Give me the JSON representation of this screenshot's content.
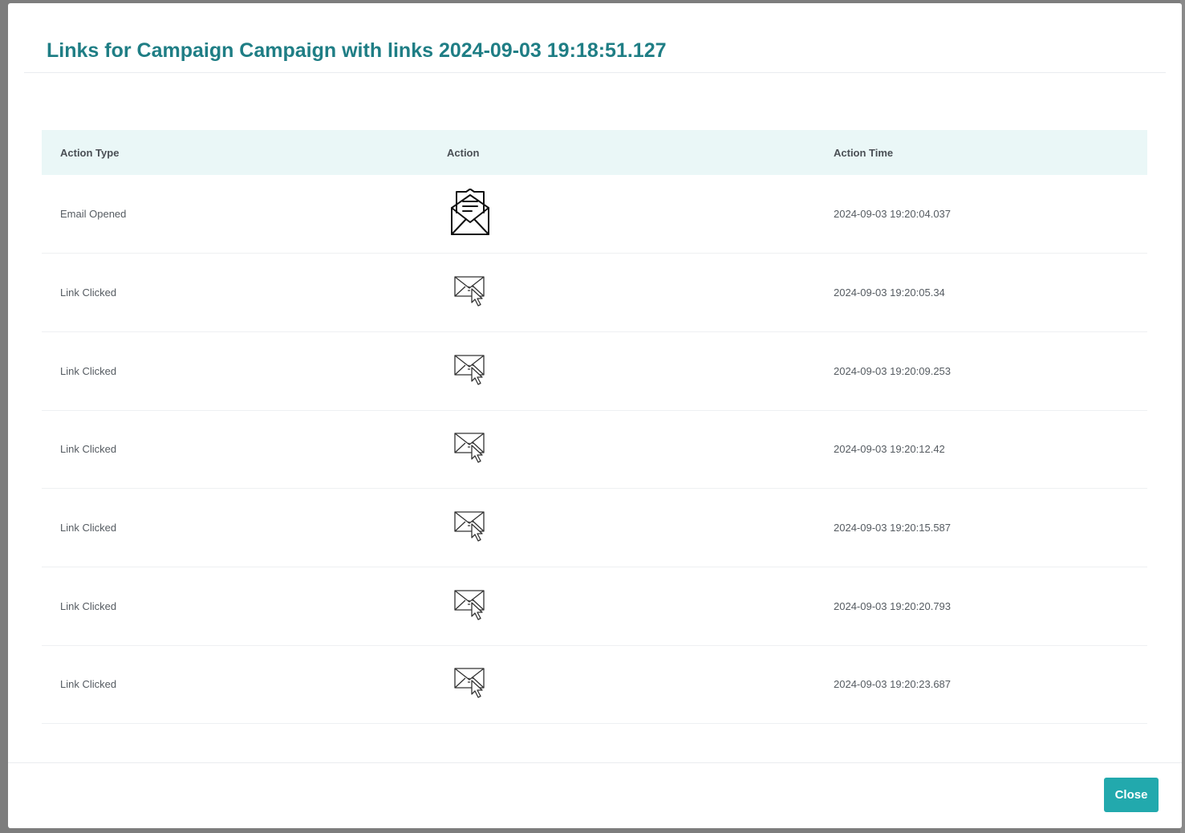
{
  "modal": {
    "title": "Links for Campaign Campaign with links 2024-09-03 19:18:51.127",
    "close_label": "Close",
    "accent_color": "#1f7e85",
    "button_color": "#22a9ad",
    "header_row_color": "#eaf7f7"
  },
  "table": {
    "columns": [
      "Action Type",
      "Action",
      "Action Time"
    ],
    "rows": [
      {
        "action_type": "Email Opened",
        "icon": "envelope-open-icon",
        "action_time": "2024-09-03 19:20:04.037"
      },
      {
        "action_type": "Link Clicked",
        "icon": "envelope-click-icon",
        "action_time": "2024-09-03 19:20:05.34"
      },
      {
        "action_type": "Link Clicked",
        "icon": "envelope-click-icon",
        "action_time": "2024-09-03 19:20:09.253"
      },
      {
        "action_type": "Link Clicked",
        "icon": "envelope-click-icon",
        "action_time": "2024-09-03 19:20:12.42"
      },
      {
        "action_type": "Link Clicked",
        "icon": "envelope-click-icon",
        "action_time": "2024-09-03 19:20:15.587"
      },
      {
        "action_type": "Link Clicked",
        "icon": "envelope-click-icon",
        "action_time": "2024-09-03 19:20:20.793"
      },
      {
        "action_type": "Link Clicked",
        "icon": "envelope-click-icon",
        "action_time": "2024-09-03 19:20:23.687"
      }
    ]
  }
}
